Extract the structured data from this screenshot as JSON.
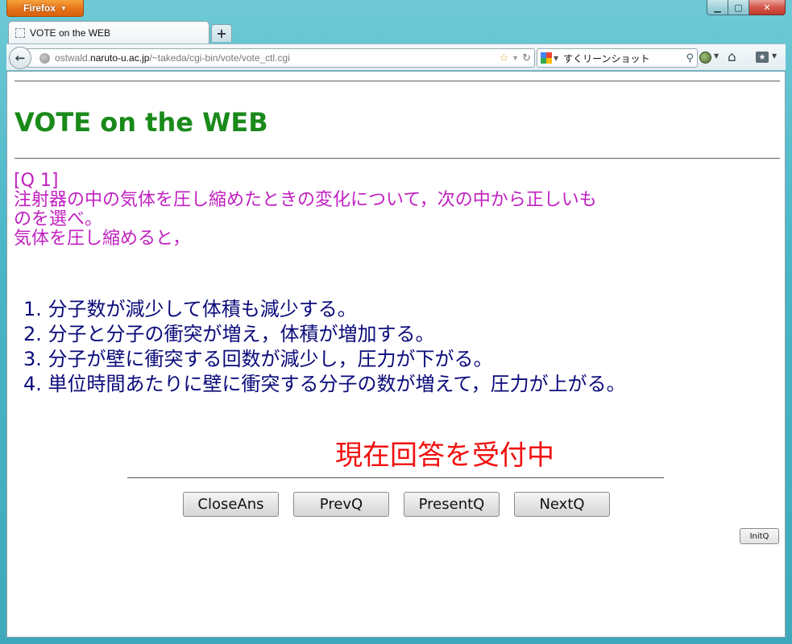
{
  "window": {
    "app_button_label": "Firefox",
    "controls": {
      "minimize": "▁",
      "maximize": "▢",
      "close": "✕"
    }
  },
  "tabs": [
    {
      "label": "VOTE on the WEB",
      "active": true
    }
  ],
  "newtab_label": "+",
  "nav": {
    "url_prefix": "ostwald.",
    "url_host": "naruto-u.ac.jp",
    "url_path": "/~takeda/cgi-bin/vote/vote_ctl.cgi",
    "search_value": "すくリーンショット",
    "icons": [
      "back-arrow-icon",
      "globe-icon",
      "star-icon",
      "reload-icon",
      "google-icon",
      "search-icon",
      "addon-icon",
      "home-icon",
      "bookmarks-icon"
    ]
  },
  "page": {
    "title": "VOTE on the WEB",
    "question_number": "[Q 1]",
    "question_lines": [
      "注射器の中の気体を圧し縮めたときの変化について，次の中から正しいも",
      "のを選べ。",
      "気体を圧し縮めると，"
    ],
    "options": [
      "1. 分子数が減少して体積も減少する。",
      "2. 分子と分子の衝突が増え，体積が増加する。",
      "3. 分子が壁に衝突する回数が減少し，圧力が下がる。",
      "4. 単位時間あたりに壁に衝突する分子の数が増えて，圧力が上がる。"
    ],
    "status": "現在回答を受付中",
    "buttons": {
      "close_ans": "CloseAns",
      "prev_q": "PrevQ",
      "present_q": "PresentQ",
      "next_q": "NextQ",
      "init_q": "InitQ"
    }
  },
  "colors": {
    "title": "#1a8a1a",
    "question": "#c020c0",
    "options": "#0a0a7a",
    "status": "#f01010"
  }
}
